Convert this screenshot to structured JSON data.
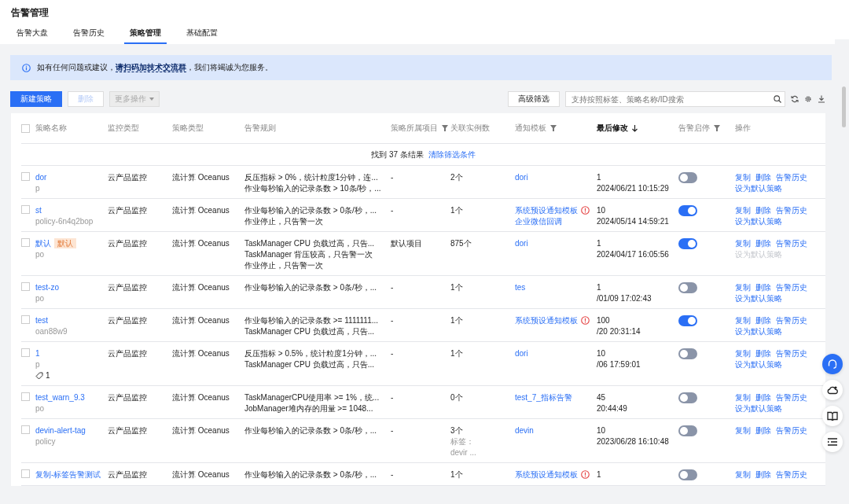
{
  "page": {
    "title": "告警管理"
  },
  "tabs": [
    {
      "label": "告警大盘",
      "selected": false
    },
    {
      "label": "告警历史",
      "selected": false
    },
    {
      "label": "策略管理",
      "selected": true
    },
    {
      "label": "基础配置",
      "selected": false
    }
  ],
  "notice": {
    "before": "如有任何问题或建议，",
    "link": "请扫码加技术交流群",
    "after": "，我们将竭诚为您服务。"
  },
  "toolbar": {
    "buttons": [
      {
        "label": "新建策略",
        "kind": "primary",
        "disabled": false
      },
      {
        "label": "删除",
        "kind": "plain",
        "disabled": true
      },
      {
        "label": "更多操作",
        "kind": "dropdown",
        "disabled": true
      }
    ],
    "filter_button": "高级筛选",
    "search": {
      "placeholder": "支持按照标签、策略名称/ID搜索"
    }
  },
  "table": {
    "columns": [
      {
        "label": "策略名称",
        "filter": false,
        "sort": false
      },
      {
        "label": "监控类型",
        "filter": false,
        "sort": false
      },
      {
        "label": "策略类型",
        "filter": false,
        "sort": false
      },
      {
        "label": "告警规则",
        "filter": false,
        "sort": false
      },
      {
        "label": "策略所属项目",
        "filter": true,
        "sort": false
      },
      {
        "label": "关联实例数",
        "filter": false,
        "sort": false
      },
      {
        "label": "通知模板",
        "filter": true,
        "sort": false
      },
      {
        "label": "最后修改",
        "filter": false,
        "sort": true
      },
      {
        "label": "告警启停",
        "filter": true,
        "sort": false
      },
      {
        "label": "操作",
        "filter": false,
        "sort": false
      }
    ],
    "select_all_checked": false,
    "result": "找到 37 条结果",
    "clear_link": "清除筛选条件",
    "rows": [
      {
        "checked": false,
        "name": "dor",
        "badge": "",
        "id": "p",
        "tag_count": "",
        "monitor": "云产品监控",
        "type": "流计算 Oceanus",
        "rules": [
          "反压指标 > 0%，统计粒度1分钟，连...",
          "作业每秒输入的记录条数 > 10条/秒，..."
        ],
        "project": "-",
        "count": [
          "2个"
        ],
        "templates": [
          {
            "text": "dori",
            "warn": false
          }
        ],
        "modified": [
          "1",
          "2024/06/21 10:15:29"
        ],
        "enabled": false,
        "actions": [
          {
            "label": "复制",
            "disabled": false
          },
          {
            "label": "删除",
            "disabled": false
          },
          {
            "label": "告警历史",
            "disabled": false
          },
          {
            "label": "设为默认策略",
            "disabled": false
          }
        ]
      },
      {
        "checked": false,
        "name": "st",
        "badge": "",
        "id": "policy-6n4q2bop",
        "tag_count": "",
        "monitor": "云产品监控",
        "type": "流计算 Oceanus",
        "rules": [
          "作业每秒输入的记录条数 > 0条/秒，...",
          "作业停止，只告警一次"
        ],
        "project": "-",
        "count": [
          "1个"
        ],
        "templates": [
          {
            "text": "系统预设通知模板",
            "warn": true
          },
          {
            "text": "企业微信回调",
            "warn": false
          }
        ],
        "modified": [
          "10",
          "2024/05/14 14:59:21"
        ],
        "enabled": true,
        "actions": [
          {
            "label": "复制",
            "disabled": false
          },
          {
            "label": "删除",
            "disabled": false
          },
          {
            "label": "告警历史",
            "disabled": false
          },
          {
            "label": "设为默认策略",
            "disabled": false
          }
        ]
      },
      {
        "checked": false,
        "name": "默认",
        "badge": "默认",
        "id": "po",
        "tag_count": "",
        "monitor": "云产品监控",
        "type": "流计算 Oceanus",
        "rules": [
          "TaskManager CPU 负载过高，只告...",
          "TaskManager 背压较高，只告警一次",
          "作业停止，只告警一次"
        ],
        "project": "默认项目",
        "count": [
          "875个"
        ],
        "templates": [
          {
            "text": "dori",
            "warn": false
          }
        ],
        "modified": [
          "1",
          "2024/04/17 16:05:56"
        ],
        "enabled": true,
        "actions": [
          {
            "label": "复制",
            "disabled": false
          },
          {
            "label": "删除",
            "disabled": false
          },
          {
            "label": "告警历史",
            "disabled": false
          },
          {
            "label": "设为默认策略",
            "disabled": true
          }
        ]
      },
      {
        "checked": false,
        "name": "test-zo",
        "badge": "",
        "id": "po",
        "tag_count": "",
        "monitor": "云产品监控",
        "type": "流计算 Oceanus",
        "rules": [
          "作业每秒输入的记录条数 > 0条/秒，..."
        ],
        "project": "-",
        "count": [
          "1个"
        ],
        "templates": [
          {
            "text": "tes",
            "warn": false
          }
        ],
        "modified": [
          "1",
          "/01/09 17:02:43"
        ],
        "enabled": false,
        "actions": [
          {
            "label": "复制",
            "disabled": false
          },
          {
            "label": "删除",
            "disabled": false
          },
          {
            "label": "告警历史",
            "disabled": false
          },
          {
            "label": "设为默认策略",
            "disabled": false
          }
        ]
      },
      {
        "checked": false,
        "name": "test",
        "badge": "",
        "id": "oan88w9",
        "tag_count": "",
        "monitor": "云产品监控",
        "type": "流计算 Oceanus",
        "rules": [
          "作业每秒输入的记录条数 >= 1111111...",
          "TaskManager CPU 负载过高，只告..."
        ],
        "project": "-",
        "count": [
          "1个"
        ],
        "templates": [
          {
            "text": "系统预设通知模板",
            "warn": true
          }
        ],
        "modified": [
          "100",
          "/20 20:31:14"
        ],
        "enabled": true,
        "actions": [
          {
            "label": "复制",
            "disabled": false
          },
          {
            "label": "删除",
            "disabled": false
          },
          {
            "label": "告警历史",
            "disabled": false
          },
          {
            "label": "设为默认策略",
            "disabled": false
          }
        ]
      },
      {
        "checked": false,
        "name": "1",
        "badge": "",
        "id": "p",
        "tag_count": "1",
        "monitor": "云产品监控",
        "type": "流计算 Oceanus",
        "rules": [
          "反压指标 > 0.5%，统计粒度1分钟，...",
          "TaskManager CPU 负载过高，只告..."
        ],
        "project": "-",
        "count": [
          "1个"
        ],
        "templates": [
          {
            "text": "dori",
            "warn": false
          }
        ],
        "modified": [
          "10",
          "/06 17:59:01"
        ],
        "enabled": false,
        "actions": [
          {
            "label": "复制",
            "disabled": false
          },
          {
            "label": "删除",
            "disabled": false
          },
          {
            "label": "告警历史",
            "disabled": false
          },
          {
            "label": "设为默认策略",
            "disabled": false
          }
        ]
      },
      {
        "checked": false,
        "name": "test_warn_9.3",
        "badge": "",
        "id": "po",
        "tag_count": "",
        "monitor": "云产品监控",
        "type": "流计算 Oceanus",
        "rules": [
          "TaskManagerCPU使用率 >= 1%，统...",
          "JobManager堆内存的用量 >= 1048..."
        ],
        "project": "-",
        "count": [
          "0个"
        ],
        "templates": [
          {
            "text": "test_7_指标告警",
            "warn": false
          }
        ],
        "modified": [
          "45",
          "20:44:49"
        ],
        "enabled": false,
        "actions": [
          {
            "label": "复制",
            "disabled": false
          },
          {
            "label": "删除",
            "disabled": false
          },
          {
            "label": "告警历史",
            "disabled": false
          },
          {
            "label": "设为默认策略",
            "disabled": false
          }
        ]
      },
      {
        "checked": false,
        "name": "devin-alert-tag",
        "badge": "",
        "id": "policy",
        "tag_count": "",
        "monitor": "云产品监控",
        "type": "流计算 Oceanus",
        "rules": [
          "作业每秒输入的记录条数 > 0条/秒，..."
        ],
        "project": "-",
        "count": [
          "3个",
          "标签：",
          "devir ..."
        ],
        "templates": [
          {
            "text": "devin",
            "warn": false
          }
        ],
        "modified": [
          "10",
          "2023/06/28 16:10:48"
        ],
        "enabled": false,
        "actions": [
          {
            "label": "复制",
            "disabled": false
          },
          {
            "label": "删除",
            "disabled": false
          },
          {
            "label": "告警历史",
            "disabled": false
          }
        ]
      },
      {
        "checked": false,
        "name": "复制-标签告警测试",
        "badge": "",
        "id": "",
        "tag_count": "",
        "monitor": "云产品监控",
        "type": "流计算 Oceanus",
        "rules": [
          "作业每秒输入的记录条数 > 0条/秒，..."
        ],
        "project": "-",
        "count": [
          "1个"
        ],
        "templates": [
          {
            "text": "系统预设通知模板",
            "warn": true
          }
        ],
        "modified": [
          "1"
        ],
        "enabled": false,
        "actions": [
          {
            "label": "复制",
            "disabled": false
          },
          {
            "label": "删除",
            "disabled": false
          },
          {
            "label": "告警历史",
            "disabled": false
          }
        ]
      }
    ]
  }
}
